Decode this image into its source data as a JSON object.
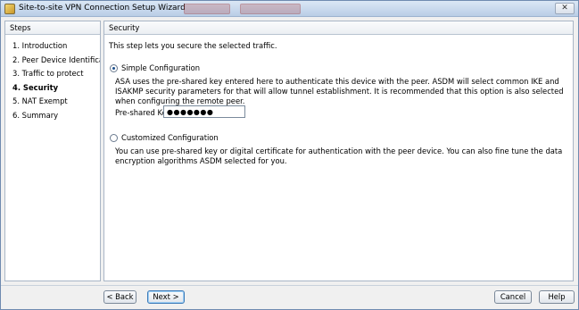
{
  "window": {
    "title": "Site-to-site VPN Connection Setup Wizard",
    "close_label": "✕"
  },
  "steps": {
    "header": "Steps",
    "items": [
      {
        "label": "1. Introduction"
      },
      {
        "label": "2. Peer Device Identificatio"
      },
      {
        "label": "3. Traffic to protect"
      },
      {
        "label": "4. Security"
      },
      {
        "label": "5. NAT Exempt"
      },
      {
        "label": "6. Summary"
      }
    ],
    "active_index": 3
  },
  "content": {
    "header": "Security",
    "intro": "This step lets you secure the selected traffic.",
    "simple": {
      "label": "Simple Configuration",
      "selected": true,
      "description": "ASA uses the pre-shared key entered here to authenticate this device with the peer. ASDM will select common IKE and ISAKMP security parameters for that will allow tunnel establishment. It is recommended that this option is also selected when configuring the remote peer.",
      "psk_label": "Pre-shared Key:",
      "psk_value": "●●●●●●●"
    },
    "custom": {
      "label": "Customized Configuration",
      "selected": false,
      "description": "You can use pre-shared key or digital certificate for authentication with the peer device. You can also fine tune the data encryption algorithms ASDM selected for you."
    }
  },
  "footer": {
    "back_label": "< Back",
    "next_label": "Next >",
    "cancel_label": "Cancel",
    "help_label": "Help"
  }
}
